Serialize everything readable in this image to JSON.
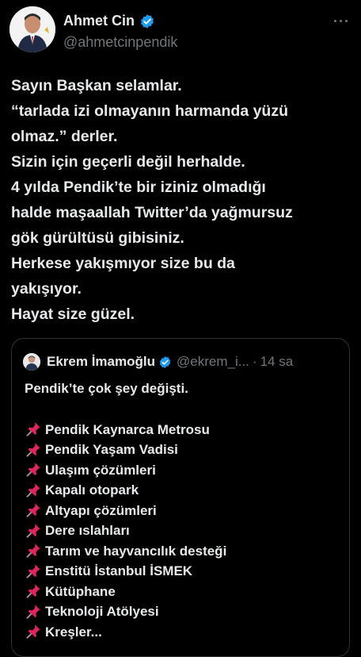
{
  "author": {
    "name": "Ahmet Cin",
    "handle": "@ahmetcinpendik",
    "avatar_icon": "avatar-photo",
    "verified_icon": "verified-badge-icon"
  },
  "tweet": {
    "lines": [
      "Sayın Başkan selamlar.",
      "“tarlada izi olmayanın harmanda yüzü",
      "olmaz.” derler.",
      "Sizin için geçerli değil herhalde.",
      "4 yılda Pendik’te bir iziniz olmadığı",
      "halde maşaallah Twitter’da yağmursuz",
      "gök gürültüsü gibisiniz.",
      "Herkese yakışmıyor size bu da",
      "yakışıyor.",
      "Hayat size güzel."
    ]
  },
  "quote": {
    "name": "Ekrem İmamoğlu",
    "handle": "@ekrem_i...",
    "separator": "·",
    "time": "14 sa",
    "intro": "Pendik’te çok şey değişti.",
    "bullet_icon": "pushpin-icon",
    "items": [
      "Pendik Kaynarca Metrosu",
      "Pendik Yaşam Vadisi",
      "Ulaşım çözümleri",
      "Kapalı otopark",
      "Altyapı çözümleri",
      "Dere ıslahları",
      "Tarım ve hayvancılık desteği",
      "Enstitü İstanbul İSMEK",
      "Kütüphane",
      "Teknoloji Atölyesi",
      "Kreşler..."
    ]
  },
  "colors": {
    "background": "#000000",
    "text": "#e7e9ea",
    "secondary": "#71767b",
    "verified": "#1d9bf0",
    "pin": "#e0245e",
    "border": "#2f3336"
  }
}
